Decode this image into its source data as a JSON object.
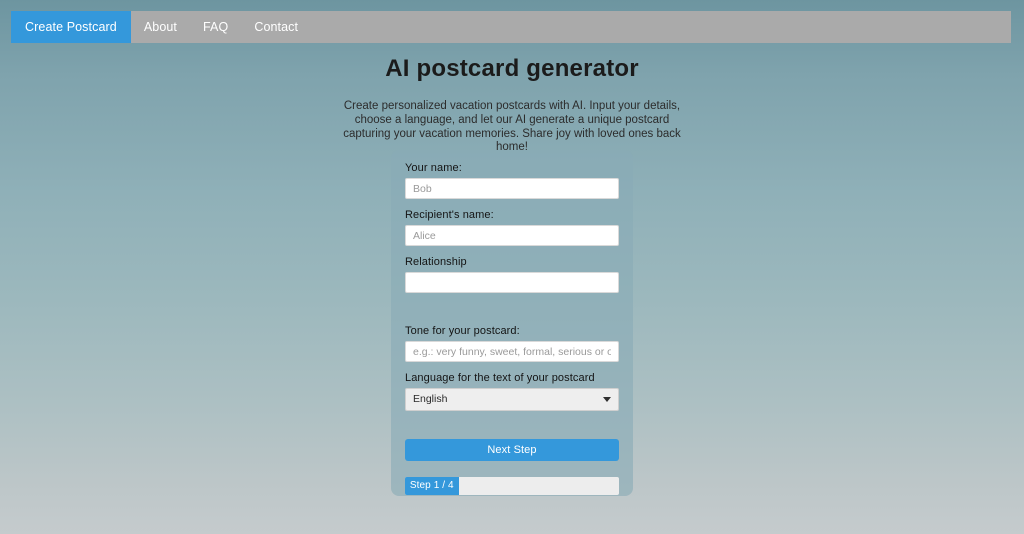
{
  "navbar": {
    "items": [
      {
        "label": "Create Postcard",
        "active": true
      },
      {
        "label": "About",
        "active": false
      },
      {
        "label": "FAQ",
        "active": false
      },
      {
        "label": "Contact",
        "active": false
      }
    ]
  },
  "header": {
    "title": "AI postcard generator",
    "description": "Create personalized vacation postcards with AI. Input your details, choose a language, and let our AI generate a unique postcard capturing your vacation memories. Share joy with loved ones back home!"
  },
  "form": {
    "your_name": {
      "label": "Your name:",
      "value": "",
      "placeholder": "Bob"
    },
    "recipient_name": {
      "label": "Recipient's name:",
      "value": "",
      "placeholder": "Alice"
    },
    "relationship": {
      "label": "Relationship",
      "value": "",
      "placeholder": ""
    },
    "tone": {
      "label": "Tone for your postcard:",
      "value": "",
      "placeholder": "e.g.: very funny, sweet, formal, serious or others"
    },
    "language": {
      "label": "Language for the text of your postcard",
      "selected": "English",
      "icon": "chevron-down-icon"
    },
    "submit": {
      "label": "Next Step"
    },
    "progress": {
      "label": "Step 1 / 4",
      "current": 1,
      "total": 4,
      "percent": 25
    }
  },
  "colors": {
    "accent": "#3498db",
    "navbar_bg": "#aaaaaa",
    "panel_bg": "#89abb6",
    "input_bg": "#ffffff",
    "select_bg": "#eeeeee",
    "progress_track": "#ededed",
    "text_dark": "#141414",
    "text_light": "#ffffff"
  }
}
